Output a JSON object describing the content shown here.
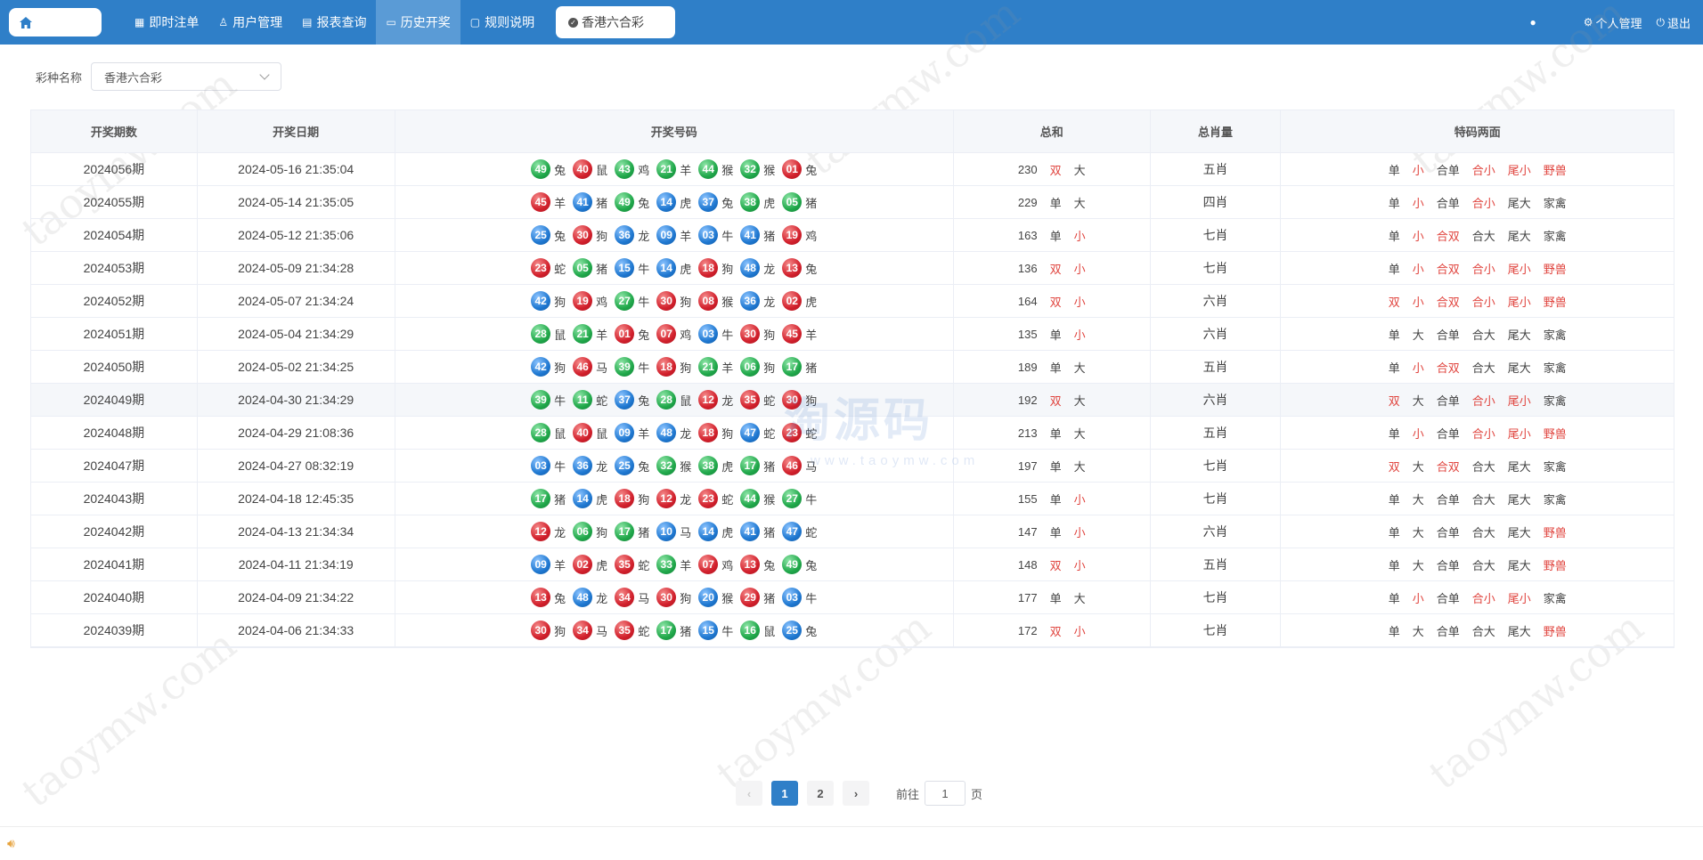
{
  "nav": {
    "items": [
      {
        "label": "即时注单",
        "icon": "grid-icon"
      },
      {
        "label": "用户管理",
        "icon": "user-icon"
      },
      {
        "label": "报表查询",
        "icon": "report-icon"
      },
      {
        "label": "历史开奖",
        "icon": "monitor-icon"
      },
      {
        "label": "规则说明",
        "icon": "chat-icon"
      }
    ],
    "lottery_tab": "香港六合彩",
    "personal": "个人管理",
    "logout": "退出"
  },
  "filter": {
    "label": "彩种名称",
    "value": "香港六合彩"
  },
  "table": {
    "headers": [
      "开奖期数",
      "开奖日期",
      "开奖号码",
      "总和",
      "总肖量",
      "特码两面"
    ],
    "rows": [
      {
        "issue": "2024056期",
        "date": "2024-05-16 21:35:04",
        "balls": [
          [
            "49",
            "green",
            "兔"
          ],
          [
            "40",
            "red",
            "鼠"
          ],
          [
            "43",
            "green",
            "鸡"
          ],
          [
            "21",
            "green",
            "羊"
          ],
          [
            "44",
            "green",
            "猴"
          ],
          [
            "32",
            "green",
            "猴"
          ],
          [
            "01",
            "red",
            "兔"
          ]
        ],
        "sum": [
          "230",
          "双",
          "大"
        ],
        "sum_red": [
          false,
          true,
          false
        ],
        "zodiac": "五肖",
        "tm": [
          "单",
          "小",
          "合单",
          "合小",
          "尾小",
          "野兽"
        ],
        "tm_red": [
          false,
          true,
          false,
          true,
          true,
          true
        ]
      },
      {
        "issue": "2024055期",
        "date": "2024-05-14 21:35:05",
        "balls": [
          [
            "45",
            "red",
            "羊"
          ],
          [
            "41",
            "blue",
            "猪"
          ],
          [
            "49",
            "green",
            "兔"
          ],
          [
            "14",
            "blue",
            "虎"
          ],
          [
            "37",
            "blue",
            "兔"
          ],
          [
            "38",
            "green",
            "虎"
          ],
          [
            "05",
            "green",
            "猪"
          ]
        ],
        "sum": [
          "229",
          "单",
          "大"
        ],
        "sum_red": [
          false,
          false,
          false
        ],
        "zodiac": "四肖",
        "tm": [
          "单",
          "小",
          "合单",
          "合小",
          "尾大",
          "家禽"
        ],
        "tm_red": [
          false,
          true,
          false,
          true,
          false,
          false
        ]
      },
      {
        "issue": "2024054期",
        "date": "2024-05-12 21:35:06",
        "balls": [
          [
            "25",
            "blue",
            "兔"
          ],
          [
            "30",
            "red",
            "狗"
          ],
          [
            "36",
            "blue",
            "龙"
          ],
          [
            "09",
            "blue",
            "羊"
          ],
          [
            "03",
            "blue",
            "牛"
          ],
          [
            "41",
            "blue",
            "猪"
          ],
          [
            "19",
            "red",
            "鸡"
          ]
        ],
        "sum": [
          "163",
          "单",
          "小"
        ],
        "sum_red": [
          false,
          false,
          true
        ],
        "zodiac": "七肖",
        "tm": [
          "单",
          "小",
          "合双",
          "合大",
          "尾大",
          "家禽"
        ],
        "tm_red": [
          false,
          true,
          true,
          false,
          false,
          false
        ]
      },
      {
        "issue": "2024053期",
        "date": "2024-05-09 21:34:28",
        "balls": [
          [
            "23",
            "red",
            "蛇"
          ],
          [
            "05",
            "green",
            "猪"
          ],
          [
            "15",
            "blue",
            "牛"
          ],
          [
            "14",
            "blue",
            "虎"
          ],
          [
            "18",
            "red",
            "狗"
          ],
          [
            "48",
            "blue",
            "龙"
          ],
          [
            "13",
            "red",
            "兔"
          ]
        ],
        "sum": [
          "136",
          "双",
          "小"
        ],
        "sum_red": [
          false,
          true,
          true
        ],
        "zodiac": "七肖",
        "tm": [
          "单",
          "小",
          "合双",
          "合小",
          "尾小",
          "野兽"
        ],
        "tm_red": [
          false,
          true,
          true,
          true,
          true,
          true
        ]
      },
      {
        "issue": "2024052期",
        "date": "2024-05-07 21:34:24",
        "balls": [
          [
            "42",
            "blue",
            "狗"
          ],
          [
            "19",
            "red",
            "鸡"
          ],
          [
            "27",
            "green",
            "牛"
          ],
          [
            "30",
            "red",
            "狗"
          ],
          [
            "08",
            "red",
            "猴"
          ],
          [
            "36",
            "blue",
            "龙"
          ],
          [
            "02",
            "red",
            "虎"
          ]
        ],
        "sum": [
          "164",
          "双",
          "小"
        ],
        "sum_red": [
          false,
          true,
          true
        ],
        "zodiac": "六肖",
        "tm": [
          "双",
          "小",
          "合双",
          "合小",
          "尾小",
          "野兽"
        ],
        "tm_red": [
          true,
          true,
          true,
          true,
          true,
          true
        ]
      },
      {
        "issue": "2024051期",
        "date": "2024-05-04 21:34:29",
        "balls": [
          [
            "28",
            "green",
            "鼠"
          ],
          [
            "21",
            "green",
            "羊"
          ],
          [
            "01",
            "red",
            "兔"
          ],
          [
            "07",
            "red",
            "鸡"
          ],
          [
            "03",
            "blue",
            "牛"
          ],
          [
            "30",
            "red",
            "狗"
          ],
          [
            "45",
            "red",
            "羊"
          ]
        ],
        "sum": [
          "135",
          "单",
          "小"
        ],
        "sum_red": [
          false,
          false,
          true
        ],
        "zodiac": "六肖",
        "tm": [
          "单",
          "大",
          "合单",
          "合大",
          "尾大",
          "家禽"
        ],
        "tm_red": [
          false,
          false,
          false,
          false,
          false,
          false
        ]
      },
      {
        "issue": "2024050期",
        "date": "2024-05-02 21:34:25",
        "balls": [
          [
            "42",
            "blue",
            "狗"
          ],
          [
            "46",
            "red",
            "马"
          ],
          [
            "39",
            "green",
            "牛"
          ],
          [
            "18",
            "red",
            "狗"
          ],
          [
            "21",
            "green",
            "羊"
          ],
          [
            "06",
            "green",
            "狗"
          ],
          [
            "17",
            "green",
            "猪"
          ]
        ],
        "sum": [
          "189",
          "单",
          "大"
        ],
        "sum_red": [
          false,
          false,
          false
        ],
        "zodiac": "五肖",
        "tm": [
          "单",
          "小",
          "合双",
          "合大",
          "尾大",
          "家禽"
        ],
        "tm_red": [
          false,
          true,
          true,
          false,
          false,
          false
        ]
      },
      {
        "issue": "2024049期",
        "date": "2024-04-30 21:34:29",
        "balls": [
          [
            "39",
            "green",
            "牛"
          ],
          [
            "11",
            "green",
            "蛇"
          ],
          [
            "37",
            "blue",
            "兔"
          ],
          [
            "28",
            "green",
            "鼠"
          ],
          [
            "12",
            "red",
            "龙"
          ],
          [
            "35",
            "red",
            "蛇"
          ],
          [
            "30",
            "red",
            "狗"
          ]
        ],
        "sum": [
          "192",
          "双",
          "大"
        ],
        "sum_red": [
          false,
          true,
          false
        ],
        "zodiac": "六肖",
        "tm": [
          "双",
          "大",
          "合单",
          "合小",
          "尾小",
          "家禽"
        ],
        "tm_red": [
          true,
          false,
          false,
          true,
          true,
          false
        ]
      },
      {
        "issue": "2024048期",
        "date": "2024-04-29 21:08:36",
        "balls": [
          [
            "28",
            "green",
            "鼠"
          ],
          [
            "40",
            "red",
            "鼠"
          ],
          [
            "09",
            "blue",
            "羊"
          ],
          [
            "48",
            "blue",
            "龙"
          ],
          [
            "18",
            "red",
            "狗"
          ],
          [
            "47",
            "blue",
            "蛇"
          ],
          [
            "23",
            "red",
            "蛇"
          ]
        ],
        "sum": [
          "213",
          "单",
          "大"
        ],
        "sum_red": [
          false,
          false,
          false
        ],
        "zodiac": "五肖",
        "tm": [
          "单",
          "小",
          "合单",
          "合小",
          "尾小",
          "野兽"
        ],
        "tm_red": [
          false,
          true,
          false,
          true,
          true,
          true
        ]
      },
      {
        "issue": "2024047期",
        "date": "2024-04-27 08:32:19",
        "balls": [
          [
            "03",
            "blue",
            "牛"
          ],
          [
            "36",
            "blue",
            "龙"
          ],
          [
            "25",
            "blue",
            "兔"
          ],
          [
            "32",
            "green",
            "猴"
          ],
          [
            "38",
            "green",
            "虎"
          ],
          [
            "17",
            "green",
            "猪"
          ],
          [
            "46",
            "red",
            "马"
          ]
        ],
        "sum": [
          "197",
          "单",
          "大"
        ],
        "sum_red": [
          false,
          false,
          false
        ],
        "zodiac": "七肖",
        "tm": [
          "双",
          "大",
          "合双",
          "合大",
          "尾大",
          "家禽"
        ],
        "tm_red": [
          true,
          false,
          true,
          false,
          false,
          false
        ]
      },
      {
        "issue": "2024043期",
        "date": "2024-04-18 12:45:35",
        "balls": [
          [
            "17",
            "green",
            "猪"
          ],
          [
            "14",
            "blue",
            "虎"
          ],
          [
            "18",
            "red",
            "狗"
          ],
          [
            "12",
            "red",
            "龙"
          ],
          [
            "23",
            "red",
            "蛇"
          ],
          [
            "44",
            "green",
            "猴"
          ],
          [
            "27",
            "green",
            "牛"
          ]
        ],
        "sum": [
          "155",
          "单",
          "小"
        ],
        "sum_red": [
          false,
          false,
          true
        ],
        "zodiac": "七肖",
        "tm": [
          "单",
          "大",
          "合单",
          "合大",
          "尾大",
          "家禽"
        ],
        "tm_red": [
          false,
          false,
          false,
          false,
          false,
          false
        ]
      },
      {
        "issue": "2024042期",
        "date": "2024-04-13 21:34:34",
        "balls": [
          [
            "12",
            "red",
            "龙"
          ],
          [
            "06",
            "green",
            "狗"
          ],
          [
            "17",
            "green",
            "猪"
          ],
          [
            "10",
            "blue",
            "马"
          ],
          [
            "14",
            "blue",
            "虎"
          ],
          [
            "41",
            "blue",
            "猪"
          ],
          [
            "47",
            "blue",
            "蛇"
          ]
        ],
        "sum": [
          "147",
          "单",
          "小"
        ],
        "sum_red": [
          false,
          false,
          true
        ],
        "zodiac": "六肖",
        "tm": [
          "单",
          "大",
          "合单",
          "合大",
          "尾大",
          "野兽"
        ],
        "tm_red": [
          false,
          false,
          false,
          false,
          false,
          true
        ]
      },
      {
        "issue": "2024041期",
        "date": "2024-04-11 21:34:19",
        "balls": [
          [
            "09",
            "blue",
            "羊"
          ],
          [
            "02",
            "red",
            "虎"
          ],
          [
            "35",
            "red",
            "蛇"
          ],
          [
            "33",
            "green",
            "羊"
          ],
          [
            "07",
            "red",
            "鸡"
          ],
          [
            "13",
            "red",
            "兔"
          ],
          [
            "49",
            "green",
            "兔"
          ]
        ],
        "sum": [
          "148",
          "双",
          "小"
        ],
        "sum_red": [
          false,
          true,
          true
        ],
        "zodiac": "五肖",
        "tm": [
          "单",
          "大",
          "合单",
          "合大",
          "尾大",
          "野兽"
        ],
        "tm_red": [
          false,
          false,
          false,
          false,
          false,
          true
        ]
      },
      {
        "issue": "2024040期",
        "date": "2024-04-09 21:34:22",
        "balls": [
          [
            "13",
            "red",
            "兔"
          ],
          [
            "48",
            "blue",
            "龙"
          ],
          [
            "34",
            "red",
            "马"
          ],
          [
            "30",
            "red",
            "狗"
          ],
          [
            "20",
            "blue",
            "猴"
          ],
          [
            "29",
            "red",
            "猪"
          ],
          [
            "03",
            "blue",
            "牛"
          ]
        ],
        "sum": [
          "177",
          "单",
          "大"
        ],
        "sum_red": [
          false,
          false,
          false
        ],
        "zodiac": "七肖",
        "tm": [
          "单",
          "小",
          "合单",
          "合小",
          "尾小",
          "家禽"
        ],
        "tm_red": [
          false,
          true,
          false,
          true,
          true,
          false
        ]
      },
      {
        "issue": "2024039期",
        "date": "2024-04-06 21:34:33",
        "balls": [
          [
            "30",
            "red",
            "狗"
          ],
          [
            "34",
            "red",
            "马"
          ],
          [
            "35",
            "red",
            "蛇"
          ],
          [
            "17",
            "green",
            "猪"
          ],
          [
            "15",
            "blue",
            "牛"
          ],
          [
            "16",
            "green",
            "鼠"
          ],
          [
            "25",
            "blue",
            "兔"
          ]
        ],
        "sum": [
          "172",
          "双",
          "小"
        ],
        "sum_red": [
          false,
          true,
          true
        ],
        "zodiac": "七肖",
        "tm": [
          "单",
          "大",
          "合单",
          "合大",
          "尾大",
          "野兽"
        ],
        "tm_red": [
          false,
          false,
          false,
          false,
          false,
          true
        ]
      }
    ],
    "highlight_row": 7
  },
  "pager": {
    "pages": [
      "1",
      "2"
    ],
    "current": "1",
    "goto_label": "前往",
    "goto_value": "1",
    "page_suffix": "页"
  },
  "colors": {
    "primary": "#2f7fc8",
    "red_text": "#e0453f"
  },
  "watermark": {
    "text": "taoymw.com",
    "logo_text": "淘源码",
    "logo_sub": "www.taoymw.com"
  }
}
